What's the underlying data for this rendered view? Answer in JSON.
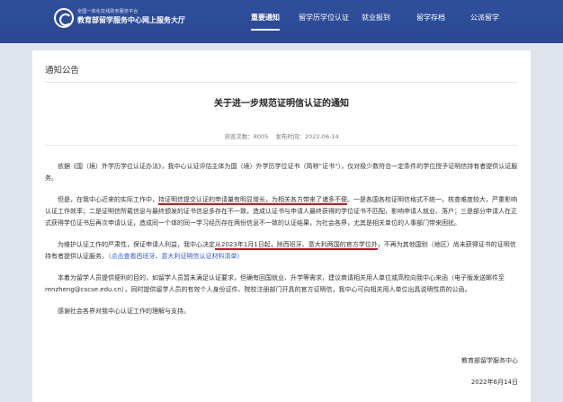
{
  "header": {
    "brand_small": "全国一体化在线政务服务平台",
    "brand_main": "教育部留学服务中心网上服务大厅",
    "nav": [
      {
        "label": "重要通知"
      },
      {
        "label": "留学历学位认证"
      },
      {
        "label": "就业报到"
      },
      {
        "label": "留学存档"
      },
      {
        "label": "公派留学"
      }
    ]
  },
  "section": {
    "title": "通知公告"
  },
  "article": {
    "title": "关于进一步规范证明信认证的通知",
    "views_label": "浏览次数：8005",
    "published_label": "发布时间：2022-06-14",
    "p1": "依据《国（境）外学历学位认证办法》，我中心认证评估主体为国（境）外学历学位证书（简称“证书”），仅对极少数符合一定条件的学位授予证明信持有者提供认证服务。",
    "p2_a": "但是，在我中心近来的实际工作中，",
    "p2_b": "持证明信提交认证的申请量有明显增长，为相关各方带来了诸多不便",
    "p2_c": "。一是各国各校证明信格式不统一，核查难度较大，严重影响认证工作效率；二是证明信所载信息与最终颁发的证书信息多存在不一致，造成认证书与申请人最终获得的学位证书不匹配，影响申请人就业、落户；三是部分申请人在正式获得学位证书后再次申请认证，造成同一个体的同一学习经历存在两份信息不一致的认证结果，为社会各界，尤其是相关单位的人事部门带来困扰。",
    "p3_a": "为维护认证工作的严肃性，保证申请人利益，我中心决定",
    "p3_b": "从2023年1月1日起，除西班牙、意大利两国的官方学位外",
    "p3_c": "，不再为其他国别（地区）尚未获得证书的证明信持有者提供认证服务。",
    "p3_link": "（点击查看西班牙、意大利证明信认证材料清单）",
    "p4": "本着为留学人员提供便利的目的，如留学人员暂未满足认证要求，但确有回国就业、升学等需求，建议商请相关用人单位或高校向我中心来函（电子版发送邮件至renzheng@cscse.edu.cn），同时提供留学人员的有效个人身份证件、院校注册部门开具的官方证明信，我中心可向相关用人单位出具说明性质的公函。",
    "p5": "感谢社会各界对我中心认证工作的理解与支持。",
    "signature": "教育部留学服务中心",
    "date": "2022年6月14日"
  },
  "colors": {
    "header_bg": "#2f4f9c",
    "underline": "#d4141b",
    "link": "#2a5bd7"
  }
}
